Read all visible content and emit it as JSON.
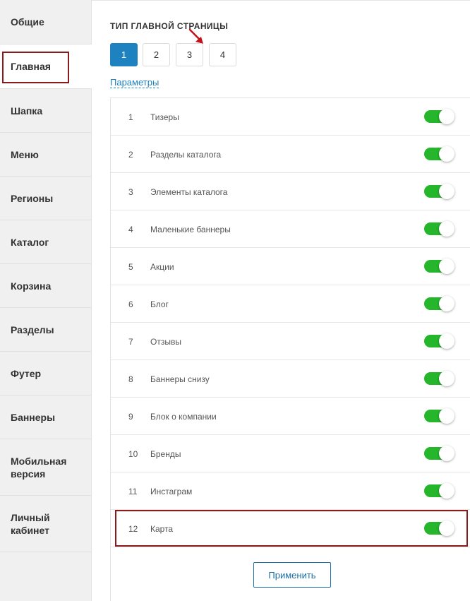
{
  "sidebar": {
    "items": [
      {
        "label": "Общие"
      },
      {
        "label": "Главная"
      },
      {
        "label": "Шапка"
      },
      {
        "label": "Меню"
      },
      {
        "label": "Регионы"
      },
      {
        "label": "Каталог"
      },
      {
        "label": "Корзина"
      },
      {
        "label": "Разделы"
      },
      {
        "label": "Футер"
      },
      {
        "label": "Баннеры"
      },
      {
        "label": "Мобильная версия"
      },
      {
        "label": "Личный кабинет"
      }
    ],
    "active_index": 1
  },
  "main": {
    "section_title": "ТИП ГЛАВНОЙ СТРАНИЦЫ",
    "type_buttons": [
      "1",
      "2",
      "3",
      "4"
    ],
    "active_type": "1",
    "params_link": "Параметры",
    "blocks": [
      {
        "num": "1",
        "label": "Тизеры",
        "enabled": true
      },
      {
        "num": "2",
        "label": "Разделы каталога",
        "enabled": true
      },
      {
        "num": "3",
        "label": "Элементы каталога",
        "enabled": true
      },
      {
        "num": "4",
        "label": "Маленькие баннеры",
        "enabled": true
      },
      {
        "num": "5",
        "label": "Акции",
        "enabled": true
      },
      {
        "num": "6",
        "label": "Блог",
        "enabled": true
      },
      {
        "num": "7",
        "label": "Отзывы",
        "enabled": true
      },
      {
        "num": "8",
        "label": "Баннеры снизу",
        "enabled": true
      },
      {
        "num": "9",
        "label": "Блок о компании",
        "enabled": true
      },
      {
        "num": "10",
        "label": "Бренды",
        "enabled": true
      },
      {
        "num": "11",
        "label": "Инстаграм",
        "enabled": true
      },
      {
        "num": "12",
        "label": "Карта",
        "enabled": true
      }
    ],
    "apply_label": "Применить"
  },
  "colors": {
    "accent": "#1f82c0",
    "toggle_on": "#25b62c",
    "highlight": "#8b1a1a"
  }
}
